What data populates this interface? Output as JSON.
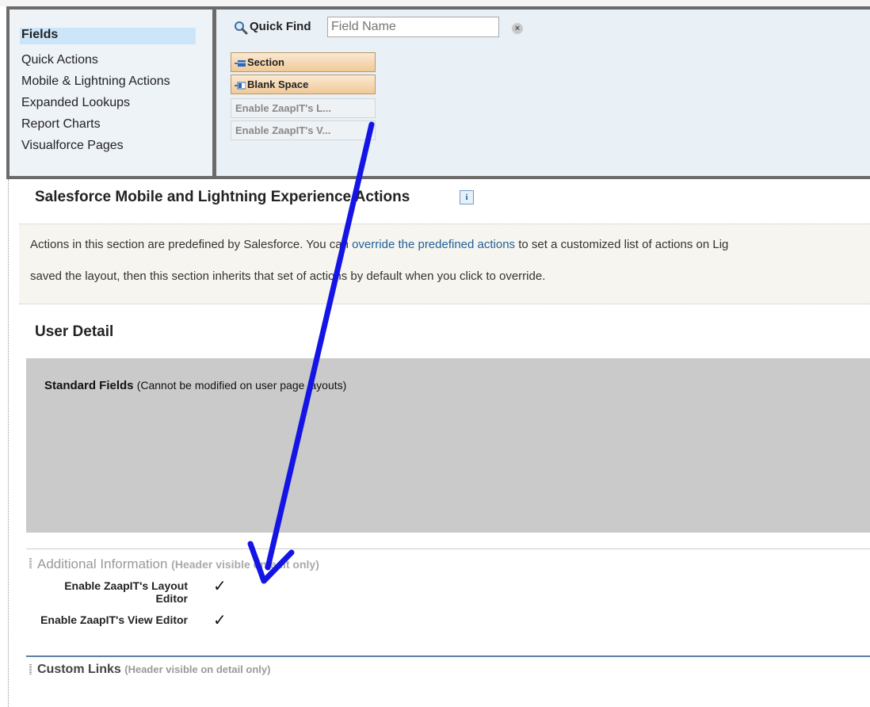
{
  "palette": {
    "categories": [
      {
        "label": "Fields",
        "active": true
      },
      {
        "label": "Quick Actions",
        "active": false
      },
      {
        "label": "Mobile & Lightning Actions",
        "active": false
      },
      {
        "label": "Expanded Lookups",
        "active": false
      },
      {
        "label": "Report Charts",
        "active": false
      },
      {
        "label": "Visualforce Pages",
        "active": false
      }
    ],
    "quick_find": {
      "label": "Quick Find",
      "placeholder": "Field Name"
    },
    "items": [
      {
        "label": "Section",
        "style": "orange",
        "icon": "add-section-icon"
      },
      {
        "label": "Blank Space",
        "style": "orange",
        "icon": "add-blank-space-icon"
      },
      {
        "label": "Enable ZaapIT's L...",
        "style": "grey"
      },
      {
        "label": "Enable ZaapIT's V...",
        "style": "grey"
      }
    ]
  },
  "mobile_section": {
    "title": "Salesforce Mobile and Lightning Experience Actions",
    "info_icon": "i",
    "notice_part1": "Actions in this section are predefined by Salesforce. You can ",
    "notice_link": "override the predefined actions",
    "notice_part2": " to set a customized list of actions on Lig",
    "notice_line2": "saved the layout, then this section inherits that set of actions by default when you click to override."
  },
  "user_detail": {
    "title": "User Detail",
    "standard_fields_title": "Standard Fields",
    "standard_fields_note": "(Cannot be modified on user page layouts)"
  },
  "additional_info": {
    "title": "Additional Information",
    "note": "(Header visible on edit only)",
    "fields": [
      {
        "label": "Enable ZaapIT's Layout Editor",
        "checked": true
      },
      {
        "label": "Enable ZaapIT's View Editor",
        "checked": true
      }
    ]
  },
  "custom_links": {
    "title": "Custom Links",
    "note": "(Header visible on detail only)"
  },
  "colors": {
    "arrow": "#1414e6",
    "active_category": "#cde5f9",
    "palette_frame": "#6b6b6b",
    "link": "#1f5f99"
  }
}
